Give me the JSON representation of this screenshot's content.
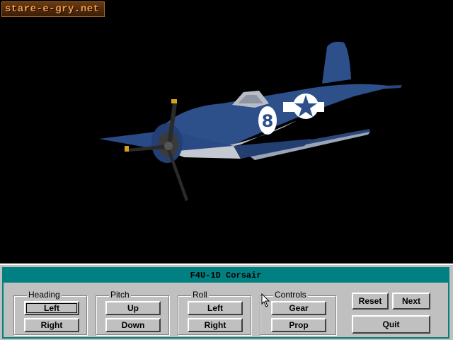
{
  "watermark": {
    "text": "stare-e-gry.net"
  },
  "scene": {
    "aircraft_marking": "8",
    "aircraft_color": "#2a4a82"
  },
  "window": {
    "title": "F4U-1D Corsair",
    "accent": "#008080"
  },
  "heading": {
    "label": "Heading",
    "left": "Left",
    "right": "Right"
  },
  "pitch": {
    "label": "Pitch",
    "up": "Up",
    "down": "Down"
  },
  "roll": {
    "label": "Roll",
    "left": "Left",
    "right": "Right"
  },
  "controls": {
    "label": "Controls",
    "gear": "Gear",
    "prop": "Prop"
  },
  "actions": {
    "reset": "Reset",
    "next": "Next",
    "quit": "Quit"
  }
}
